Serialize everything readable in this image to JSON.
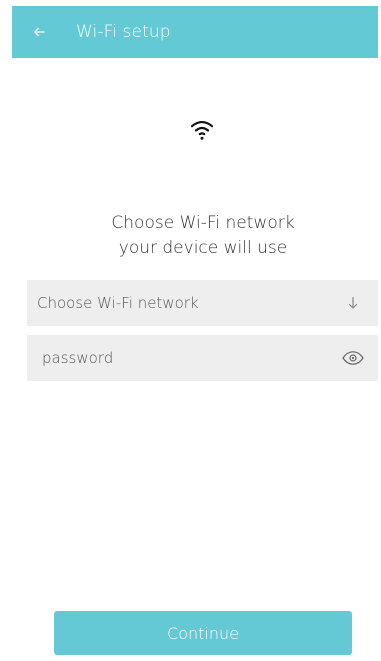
{
  "header": {
    "title": "Wi-Fi setup",
    "back_icon": "back-arrow-icon"
  },
  "main": {
    "status_icon": "wifi-icon",
    "headline_line_1": "Choose Wi-Fi network",
    "headline_line_2": "your device will use"
  },
  "form": {
    "network_selector": {
      "value": "Choose Wi-Fi network",
      "icon": "down-arrow-icon"
    },
    "password": {
      "placeholder": "password",
      "icon": "eye-icon"
    }
  },
  "actions": {
    "continue_label": "Continue"
  },
  "colors": {
    "accent": "#63c9d4",
    "input_background": "#eeeeee",
    "text": "#333333"
  }
}
